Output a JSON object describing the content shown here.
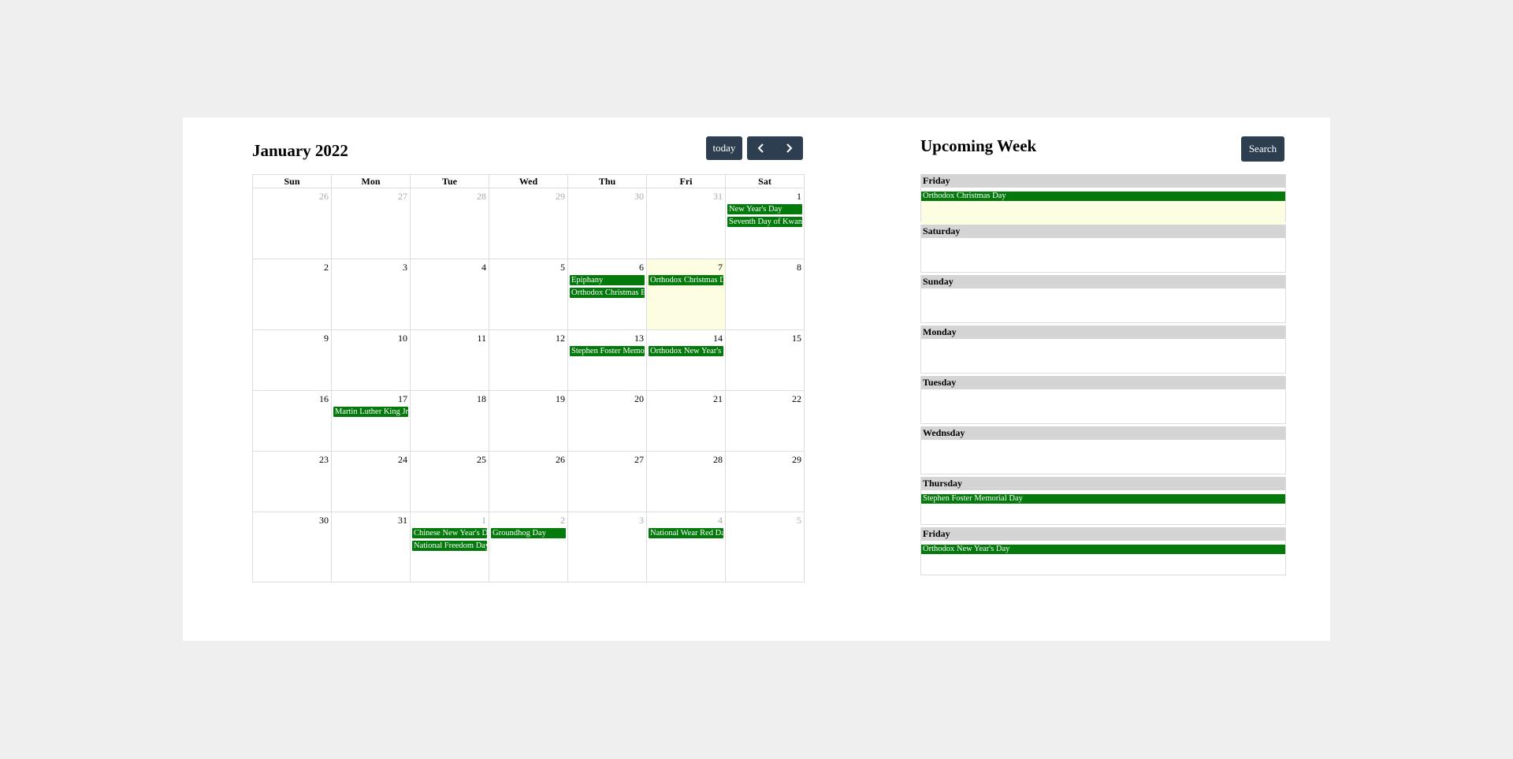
{
  "calendar": {
    "title": "January 2022",
    "today_label": "today",
    "weekdays": [
      "Sun",
      "Mon",
      "Tue",
      "Wed",
      "Thu",
      "Fri",
      "Sat"
    ],
    "weeks": [
      [
        {
          "d": "26",
          "other": true,
          "events": []
        },
        {
          "d": "27",
          "other": true,
          "events": []
        },
        {
          "d": "28",
          "other": true,
          "events": []
        },
        {
          "d": "29",
          "other": true,
          "events": []
        },
        {
          "d": "30",
          "other": true,
          "events": []
        },
        {
          "d": "31",
          "other": true,
          "events": []
        },
        {
          "d": "1",
          "events": [
            "New Year's Day",
            "Seventh Day of Kwanzaa"
          ]
        }
      ],
      [
        {
          "d": "2",
          "events": []
        },
        {
          "d": "3",
          "events": []
        },
        {
          "d": "4",
          "events": []
        },
        {
          "d": "5",
          "events": []
        },
        {
          "d": "6",
          "events": [
            "Epiphany",
            "Orthodox Christmas Eve"
          ]
        },
        {
          "d": "7",
          "today": true,
          "events": [
            "Orthodox Christmas Day"
          ]
        },
        {
          "d": "8",
          "events": []
        }
      ],
      [
        {
          "d": "9",
          "events": []
        },
        {
          "d": "10",
          "events": []
        },
        {
          "d": "11",
          "events": []
        },
        {
          "d": "12",
          "events": []
        },
        {
          "d": "13",
          "events": [
            "Stephen Foster Memorial Day"
          ]
        },
        {
          "d": "14",
          "events": [
            "Orthodox New Year's Day"
          ]
        },
        {
          "d": "15",
          "events": []
        }
      ],
      [
        {
          "d": "16",
          "events": []
        },
        {
          "d": "17",
          "events": [
            "Martin Luther King Jr. Day"
          ]
        },
        {
          "d": "18",
          "events": []
        },
        {
          "d": "19",
          "events": []
        },
        {
          "d": "20",
          "events": []
        },
        {
          "d": "21",
          "events": []
        },
        {
          "d": "22",
          "events": []
        }
      ],
      [
        {
          "d": "23",
          "events": []
        },
        {
          "d": "24",
          "events": []
        },
        {
          "d": "25",
          "events": []
        },
        {
          "d": "26",
          "events": []
        },
        {
          "d": "27",
          "events": []
        },
        {
          "d": "28",
          "events": []
        },
        {
          "d": "29",
          "events": []
        }
      ],
      [
        {
          "d": "30",
          "events": []
        },
        {
          "d": "31",
          "events": []
        },
        {
          "d": "1",
          "other": true,
          "events": [
            "Chinese New Year's Day",
            "National Freedom Day"
          ]
        },
        {
          "d": "2",
          "other": true,
          "events": [
            "Groundhog Day"
          ]
        },
        {
          "d": "3",
          "other": true,
          "events": []
        },
        {
          "d": "4",
          "other": true,
          "events": [
            "National Wear Red Day"
          ]
        },
        {
          "d": "5",
          "other": true,
          "events": []
        }
      ]
    ]
  },
  "upcoming": {
    "title": "Upcoming Week",
    "search_label": "Search",
    "days": [
      {
        "label": "Friday",
        "highlight": true,
        "events": [
          "Orthodox Christmas Day"
        ]
      },
      {
        "label": "Saturday",
        "events": []
      },
      {
        "label": "Sunday",
        "events": []
      },
      {
        "label": "Monday",
        "events": []
      },
      {
        "label": "Tuesday",
        "events": []
      },
      {
        "label": "Wednsday",
        "events": []
      },
      {
        "label": "Thursday",
        "events": [
          "Stephen Foster Memorial Day"
        ]
      },
      {
        "label": "Friday",
        "events": [
          "Orthodox New Year's Day"
        ]
      }
    ]
  },
  "colors": {
    "event": "#037a0b",
    "button": "#2c3e50",
    "today_bg": "#fdfde2",
    "day_header": "#d4d4d4"
  }
}
